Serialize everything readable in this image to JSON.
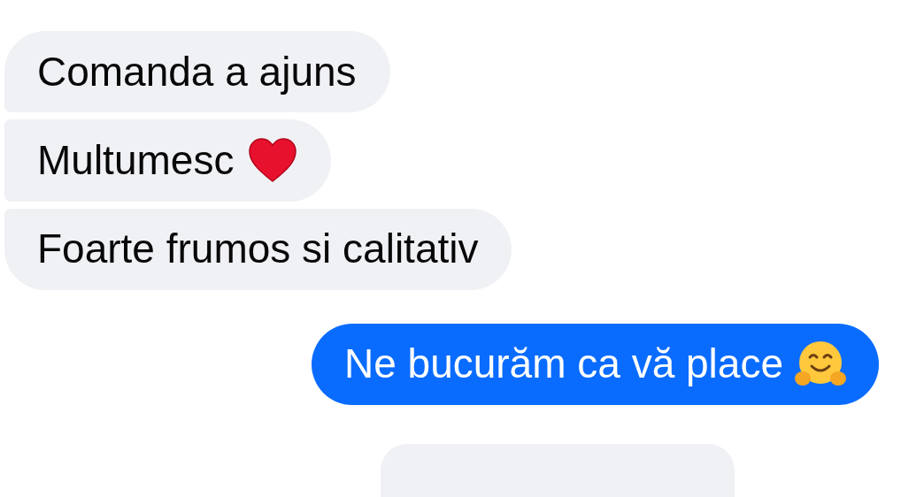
{
  "messages": [
    {
      "kind": "incoming",
      "text": "Comanda a ajuns"
    },
    {
      "kind": "incoming",
      "text": "Multumesc",
      "emoji": {
        "kind": "heart"
      }
    },
    {
      "kind": "incoming",
      "text": "Foarte frumos si calitativ"
    },
    {
      "kind": "outgoing",
      "text": "Ne bucurăm ca vă place",
      "emoji": {
        "kind": "hug"
      }
    },
    {
      "kind": "cut-off"
    }
  ]
}
